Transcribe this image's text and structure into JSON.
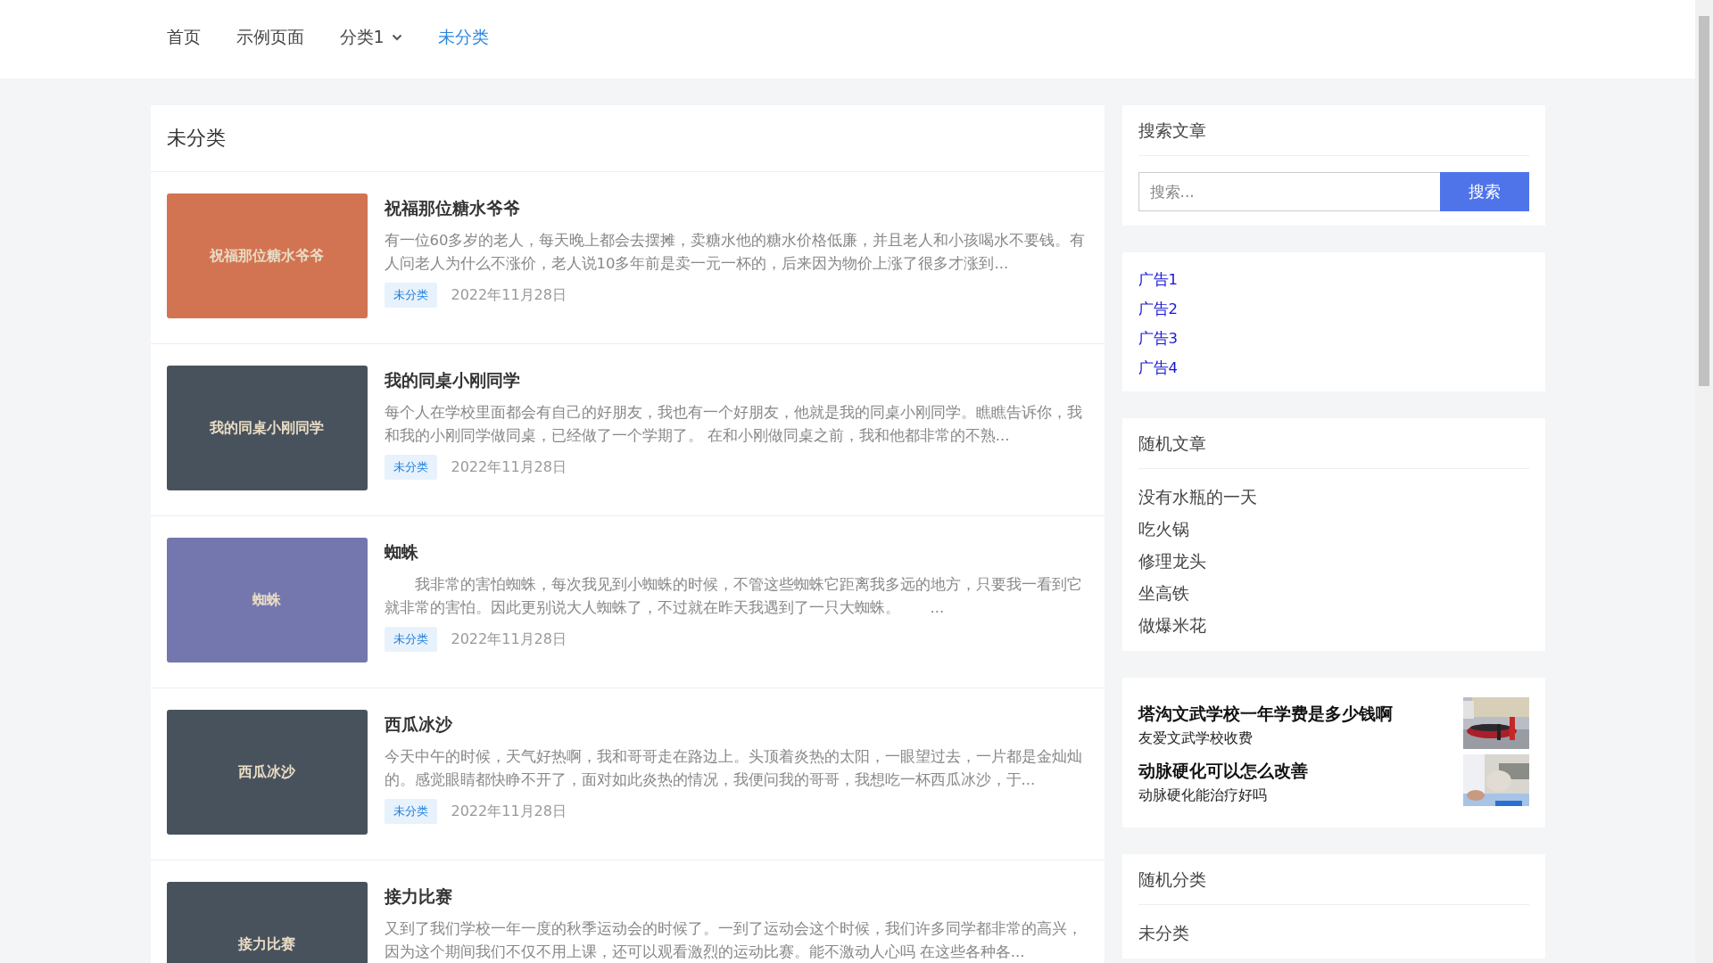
{
  "nav": [
    {
      "label": "首页",
      "selected": false,
      "dropdown": false
    },
    {
      "label": "示例页面",
      "selected": false,
      "dropdown": false
    },
    {
      "label": "分类1",
      "selected": false,
      "dropdown": true
    },
    {
      "label": "未分类",
      "selected": true,
      "dropdown": false
    }
  ],
  "category_title": "未分类",
  "posts": [
    {
      "title": "祝福那位糖水爷爷",
      "thumb_text": "祝福那位糖水爷爷",
      "color": "#d27452",
      "excerpt": "有一位60多岁的老人，每天晚上都会去摆摊，卖糖水他的糖水价格低廉，并且老人和小孩喝水不要钱。有人问老人为什么不涨价，老人说10多年前是卖一元一杯的，后来因为物价上涨了很多才涨到...",
      "tag": "未分类",
      "date": "2022年11月28日"
    },
    {
      "title": "我的同桌小刚同学",
      "thumb_text": "我的同桌小刚同学",
      "color": "#48525d",
      "excerpt": "每个人在学校里面都会有自己的好朋友，我也有一个好朋友，他就是我的同桌小刚同学。瞧瞧告诉你，我和我的小刚同学做同桌，已经做了一个学期了。 在和小刚做同桌之前，我和他都非常的不熟...",
      "tag": "未分类",
      "date": "2022年11月28日"
    },
    {
      "title": "蜘蛛",
      "thumb_text": "蜘蛛",
      "color": "#7477ae",
      "excerpt": "　　我非常的害怕蜘蛛，每次我见到小蜘蛛的时候，不管这些蜘蛛它距离我多远的地方，只要我一看到它就非常的害怕。因此更别说大人蜘蛛了，不过就在昨天我遇到了一只大蜘蛛。　　...",
      "tag": "未分类",
      "date": "2022年11月28日"
    },
    {
      "title": "西瓜冰沙",
      "thumb_text": "西瓜冰沙",
      "color": "#48525d",
      "excerpt": "今天中午的时候，天气好热啊，我和哥哥走在路边上。头顶着炎热的太阳，一眼望过去，一片都是金灿灿的。感觉眼睛都快睁不开了，面对如此炎热的情况，我便问我的哥哥，我想吃一杯西瓜冰沙，于...",
      "tag": "未分类",
      "date": "2022年11月28日"
    },
    {
      "title": "接力比赛",
      "thumb_text": "接力比赛",
      "color": "#48525d",
      "excerpt": "又到了我们学校一年一度的秋季运动会的时候了。一到了运动会这个时候，我们许多同学都非常的高兴，因为这个期间我们不仅不用上课，还可以观看激烈的运动比赛。能不激动人心吗 在这些各种各..."
    }
  ],
  "search": {
    "title": "搜索文章",
    "placeholder": "搜索...",
    "button": "搜索"
  },
  "ad_links": [
    "广告1",
    "广告2",
    "广告3",
    "广告4"
  ],
  "random_posts": {
    "title": "随机文章",
    "items": [
      "没有水瓶的一天",
      "吃火锅",
      "修理龙头",
      "坐高铁",
      "做爆米花"
    ]
  },
  "promos": [
    {
      "title": "塔沟文武学校一年学费是多少钱啊",
      "subtitle": "友爱文武学校收费",
      "kind": "picture"
    },
    {
      "title": "动脉硬化可以怎么改善",
      "subtitle": "动脉硬化能治疗好吗",
      "kind": "picture"
    }
  ],
  "random_categories": {
    "title": "随机分类",
    "items": [
      "未分类"
    ]
  }
}
